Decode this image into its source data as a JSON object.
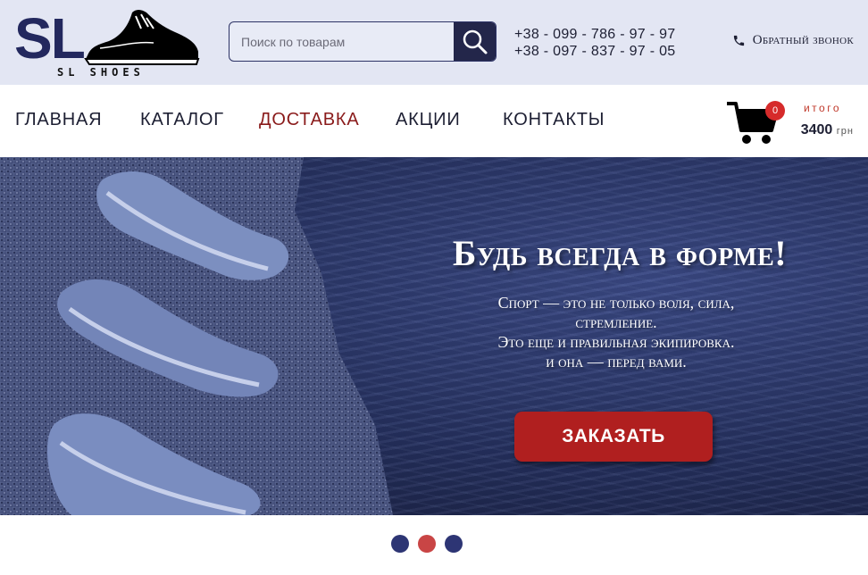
{
  "brand": {
    "logo_main": "SL",
    "logo_sub": "SL SHOES"
  },
  "search": {
    "placeholder": "Поиск по товарам",
    "icon": "search-icon"
  },
  "contacts": {
    "phones": [
      "+38 - 099 - 786 - 97 - 97",
      "+38 - 097 - 837 - 97 - 05"
    ],
    "callback_label": "Обратный звонок",
    "callback_icon": "phone-icon"
  },
  "nav": {
    "items": [
      {
        "label": "ГЛАВНАЯ",
        "active": false
      },
      {
        "label": "КАТАЛОГ",
        "active": false
      },
      {
        "label": "ДОСТАВКА",
        "active": true
      },
      {
        "label": "АКЦИИ",
        "active": false
      },
      {
        "label": "КОНТАКТЫ",
        "active": false
      }
    ]
  },
  "cart": {
    "count": "0",
    "total_label": "итого",
    "total_value": "3400",
    "currency": "грн",
    "icon": "cart-icon"
  },
  "hero": {
    "title": "Будь всегда в форме!",
    "lines": [
      "Спорт — это не только воля, сила,",
      "стремление.",
      "Это еще и правильная экипировка.",
      "и она — перед вами."
    ],
    "cta_label": "ЗАКАЗАТЬ"
  },
  "slider": {
    "count": 3,
    "active_index": 1
  },
  "colors": {
    "brand_navy": "#23285e",
    "accent_red": "#b01f1f",
    "active_nav": "#8a1b1b",
    "topbar_bg": "#e3e6f3"
  }
}
